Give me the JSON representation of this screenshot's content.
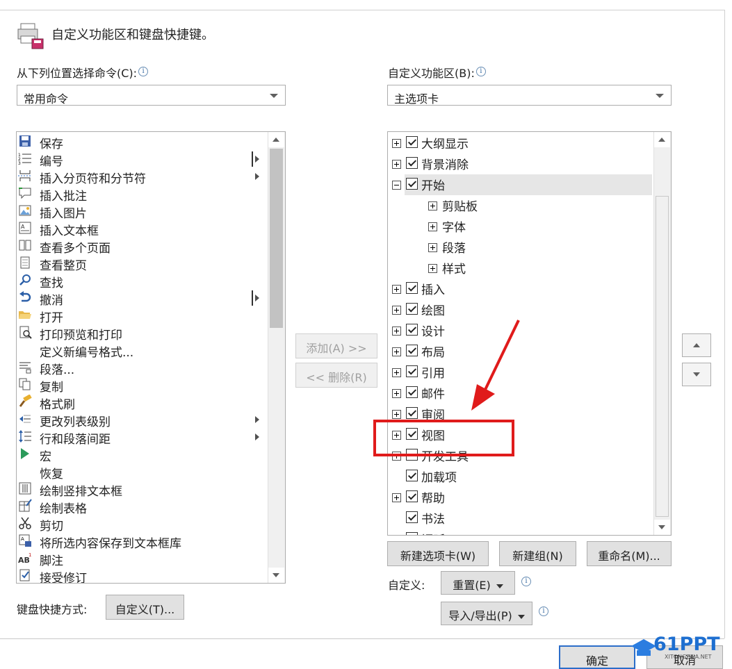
{
  "header": {
    "title": "自定义功能区和键盘快捷键。",
    "icon": "options-icon"
  },
  "left": {
    "label": "从下列位置选择命令(C):",
    "combo_value": "常用命令",
    "commands": [
      {
        "label": "保存",
        "icon": "save-icon"
      },
      {
        "label": "编号",
        "icon": "numbering-icon",
        "submenu": true,
        "split": true
      },
      {
        "label": "插入分页符和分节符",
        "icon": "page-break-icon",
        "submenu": true
      },
      {
        "label": "插入批注",
        "icon": "comment-icon"
      },
      {
        "label": "插入图片",
        "icon": "picture-icon"
      },
      {
        "label": "插入文本框",
        "icon": "textbox-icon"
      },
      {
        "label": "查看多个页面",
        "icon": "multipage-icon"
      },
      {
        "label": "查看整页",
        "icon": "page-icon"
      },
      {
        "label": "查找",
        "icon": "find-icon"
      },
      {
        "label": "撤消",
        "icon": "undo-icon",
        "submenu": true,
        "split": true
      },
      {
        "label": "打开",
        "icon": "open-folder-icon"
      },
      {
        "label": "打印预览和打印",
        "icon": "print-preview-icon"
      },
      {
        "label": "定义新编号格式...",
        "icon": ""
      },
      {
        "label": "段落...",
        "icon": "paragraph-icon"
      },
      {
        "label": "复制",
        "icon": "copy-icon"
      },
      {
        "label": "格式刷",
        "icon": "format-painter-icon"
      },
      {
        "label": "更改列表级别",
        "icon": "list-level-icon",
        "submenu": true
      },
      {
        "label": "行和段落间距",
        "icon": "line-spacing-icon",
        "submenu": true
      },
      {
        "label": "宏",
        "icon": "macro-icon"
      },
      {
        "label": "恢复",
        "icon": ""
      },
      {
        "label": "绘制竖排文本框",
        "icon": "vertical-textbox-icon"
      },
      {
        "label": "绘制表格",
        "icon": "draw-table-icon"
      },
      {
        "label": "剪切",
        "icon": "cut-icon"
      },
      {
        "label": "将所选内容保存到文本框库",
        "icon": "save-textbox-icon"
      },
      {
        "label": "脚注",
        "icon": "footnote-icon"
      },
      {
        "label": "接受修订",
        "icon": "accept-icon"
      }
    ]
  },
  "right": {
    "label": "自定义功能区(B):",
    "combo_value": "主选项卡",
    "tabs": [
      {
        "label": "大纲显示",
        "expand": "plus",
        "checked": true,
        "level": 0
      },
      {
        "label": "背景消除",
        "expand": "plus",
        "checked": true,
        "level": 0
      },
      {
        "label": "开始",
        "expand": "minus",
        "checked": true,
        "level": 0,
        "selected": true
      },
      {
        "label": "剪贴板",
        "expand": "plus",
        "level": 1
      },
      {
        "label": "字体",
        "expand": "plus",
        "level": 1
      },
      {
        "label": "段落",
        "expand": "plus",
        "level": 1
      },
      {
        "label": "样式",
        "expand": "plus",
        "level": 1
      },
      {
        "label": "插入",
        "expand": "plus",
        "checked": true,
        "level": 0
      },
      {
        "label": "绘图",
        "expand": "plus",
        "checked": true,
        "level": 0
      },
      {
        "label": "设计",
        "expand": "plus",
        "checked": true,
        "level": 0
      },
      {
        "label": "布局",
        "expand": "plus",
        "checked": true,
        "level": 0
      },
      {
        "label": "引用",
        "expand": "plus",
        "checked": true,
        "level": 0
      },
      {
        "label": "邮件",
        "expand": "plus",
        "checked": true,
        "level": 0
      },
      {
        "label": "审阅",
        "expand": "plus",
        "checked": true,
        "level": 0
      },
      {
        "label": "视图",
        "expand": "plus",
        "checked": true,
        "level": 0
      },
      {
        "label": "开发工具",
        "expand": "plus",
        "checked": false,
        "level": 0
      },
      {
        "label": "加载项",
        "expand": "none",
        "checked": true,
        "level": 0
      },
      {
        "label": "帮助",
        "expand": "plus",
        "checked": true,
        "level": 0
      },
      {
        "label": "书法",
        "expand": "none",
        "checked": true,
        "level": 0
      },
      {
        "label": "福昕PDF",
        "expand": "plus",
        "checked": true,
        "level": 0
      }
    ],
    "new_tab": "新建选项卡(W)",
    "new_group": "新建组(N)",
    "rename": "重命名(M)...",
    "customize_label": "自定义:",
    "reset": "重置(E)",
    "import_export": "导入/导出(P)"
  },
  "middle": {
    "add": "添加(A) >>",
    "remove": "<< 删除(R)"
  },
  "keyboard": {
    "label": "键盘快捷方式:",
    "button": "自定义(T)..."
  },
  "footer": {
    "ok": "确定",
    "cancel": "取消"
  },
  "watermark": {
    "brand": "61PPT",
    "url": "XITONGZIJIA.NET"
  },
  "colors": {
    "highlight": "#e01b1b",
    "selected_row": "#e6e6e6"
  }
}
